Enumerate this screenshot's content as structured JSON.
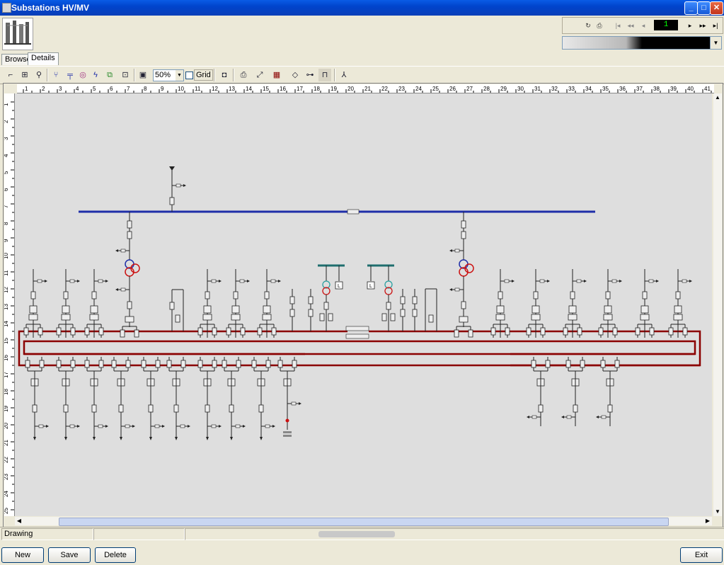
{
  "window": {
    "title": "Substations HV/MV"
  },
  "window_buttons": {
    "minimize": "_",
    "maximize": "□",
    "close": "✕"
  },
  "navigator": {
    "page": "1"
  },
  "tabs": [
    {
      "label": "Browse"
    },
    {
      "label": "Details"
    }
  ],
  "toolbar": {
    "zoom_value": "50%",
    "grid_label": "Grid"
  },
  "ruler": {
    "h_ticks": [
      "1",
      "2",
      "3",
      "4",
      "5",
      "6",
      "7",
      "8",
      "9",
      "10",
      "11",
      "12",
      "13",
      "14",
      "15",
      "16",
      "17",
      "18",
      "19",
      "20",
      "21",
      "22",
      "23",
      "24",
      "25",
      "26",
      "27",
      "28",
      "29",
      "30",
      "31",
      "32",
      "33",
      "34",
      "35",
      "36",
      "37",
      "38",
      "39",
      "40",
      "41"
    ],
    "v_ticks": [
      "1",
      "2",
      "3",
      "4",
      "5",
      "6",
      "7",
      "8",
      "9",
      "10",
      "11",
      "12",
      "13",
      "14",
      "15",
      "16",
      "17",
      "18",
      "19",
      "20",
      "21",
      "22",
      "23",
      "24",
      "25"
    ]
  },
  "diagram": {
    "hv_bus_color": "#1f2fa8",
    "mv_bus_color": "#8b0000",
    "teal_bus_color": "#1f6e6e",
    "transformer_blue": "#1f2fa8",
    "transformer_red": "#cc1111",
    "transformer_cyan": "#2aa0a0",
    "box_label": "L"
  },
  "status": {
    "mode": "Drawing"
  },
  "buttons": {
    "new": "New",
    "save": "Save",
    "delete": "Delete",
    "exit": "Exit"
  }
}
